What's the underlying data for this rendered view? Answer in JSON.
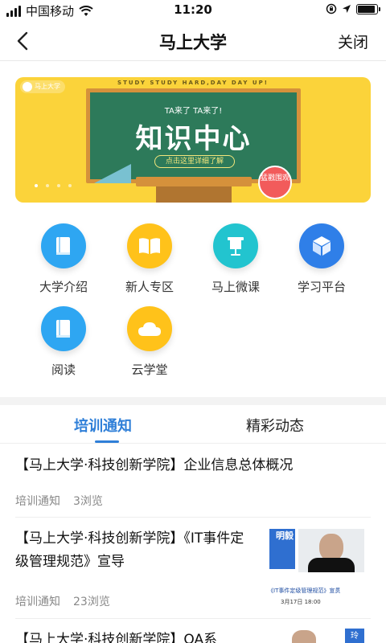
{
  "status_bar": {
    "carrier": "中国移动",
    "time": "11:20",
    "battery_level": 0.9
  },
  "nav": {
    "title": "马上大学",
    "close_label": "关闭"
  },
  "banner": {
    "brand": "马上大学",
    "slogan": "STUDY STUDY HARD,DAY DAY UP!",
    "small_text": "TA来了 TA来了!",
    "headline": "知识中心",
    "cta": "点击这里详细了解",
    "stamp": "猛戳围观",
    "page_count": 4,
    "active_page": 0
  },
  "shortcuts": [
    {
      "label": "大学介绍",
      "icon": "book-icon",
      "color": "#2ea6f2"
    },
    {
      "label": "新人专区",
      "icon": "open-book-icon",
      "color": "#ffc21a"
    },
    {
      "label": "马上微课",
      "icon": "lectern-icon",
      "color": "#22c4cf"
    },
    {
      "label": "学习平台",
      "icon": "cube-icon",
      "color": "#2f7fe8"
    },
    {
      "label": "阅读",
      "icon": "book-icon",
      "color": "#2ea6f2"
    },
    {
      "label": "云学堂",
      "icon": "cloud-icon",
      "color": "#ffc21a"
    }
  ],
  "tabs": [
    {
      "label": "培训通知"
    },
    {
      "label": "精彩动态"
    }
  ],
  "articles": [
    {
      "title": "【马上大学·科技创新学院】企业信息总体概况",
      "category": "培训通知",
      "views": "3浏览"
    },
    {
      "title": "【马上大学·科技创新学院】《IT事件定级管理规范》宣导",
      "category": "培训通知",
      "views": "23浏览",
      "thumb_caption": "《IT事件定级管理规范》宣贯",
      "thumb_date": "3月17日 18:00",
      "thumb_name": "明毅"
    },
    {
      "title": "【马上大学·科技创新学院】OA系",
      "thumb_name": "玲"
    }
  ]
}
